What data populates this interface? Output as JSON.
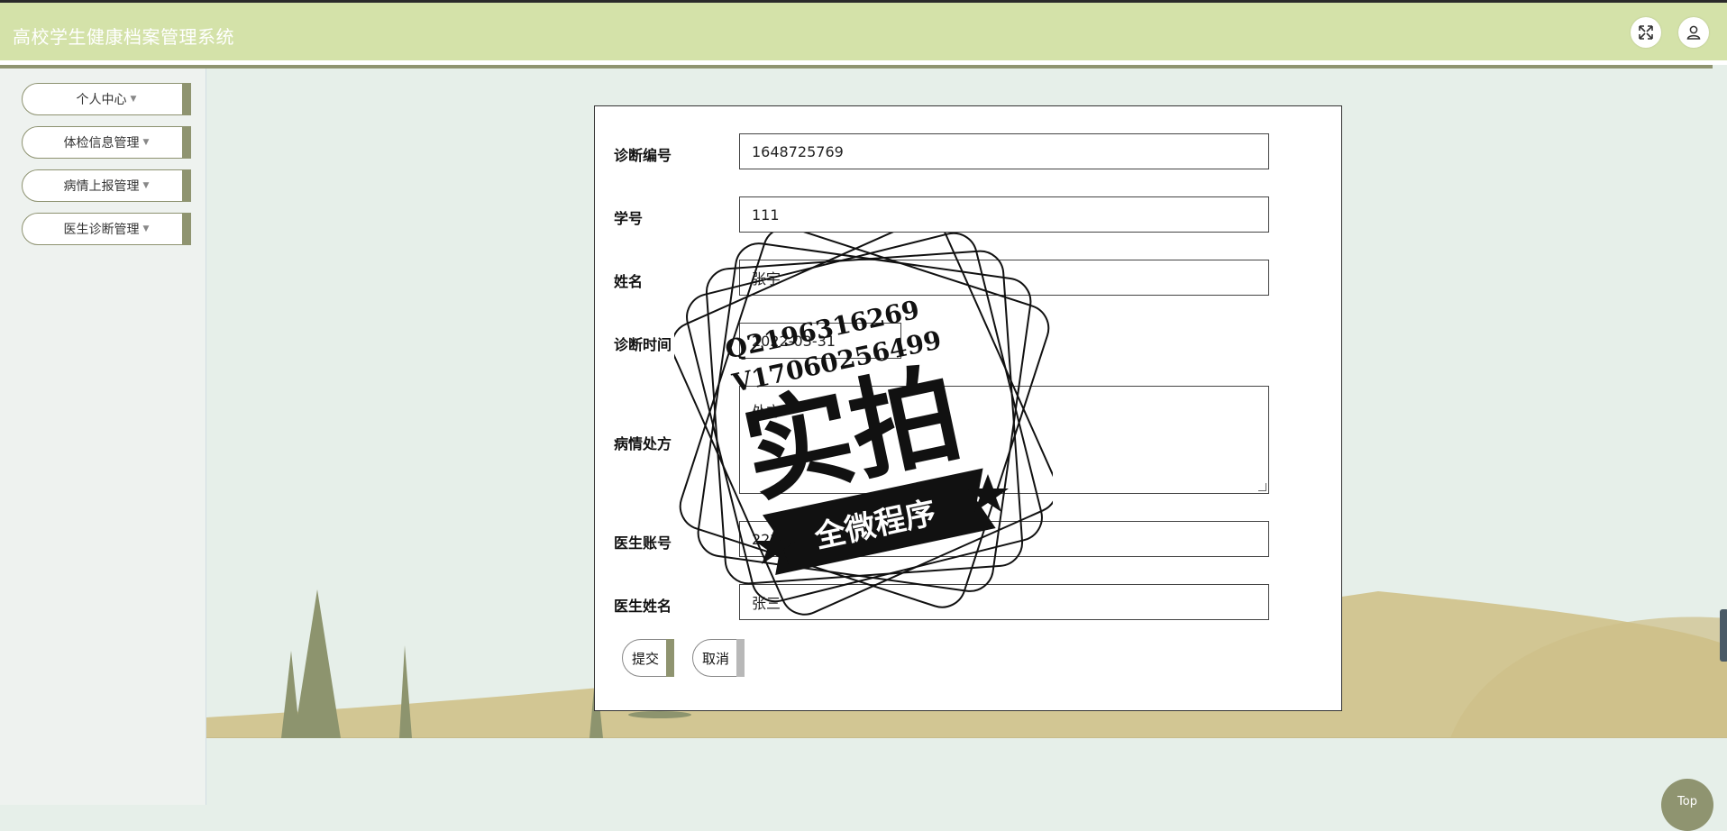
{
  "app": {
    "title": "高校学生健康档案管理系统"
  },
  "header": {
    "fullscreen_icon": "expand-icon",
    "user_icon": "user-icon"
  },
  "sidebar": {
    "items": [
      {
        "label": "个人中心"
      },
      {
        "label": "体检信息管理"
      },
      {
        "label": "病情上报管理"
      },
      {
        "label": "医生诊断管理"
      }
    ]
  },
  "form": {
    "fields": [
      {
        "label": "诊断编号",
        "value": "1648725769"
      },
      {
        "label": "学号",
        "value": "111"
      },
      {
        "label": "姓名",
        "value": "张宇"
      },
      {
        "label": "诊断时间",
        "value": "2022-03-31"
      },
      {
        "label": "病情处方",
        "value": "处方"
      },
      {
        "label": "医生账号",
        "value": "222"
      },
      {
        "label": "医生姓名",
        "value": "张三"
      }
    ],
    "submit_label": "提交",
    "cancel_label": "取消"
  },
  "watermark": {
    "qq": "Q2196316269",
    "vx": "V17060256499",
    "big_text": "实拍",
    "ribbon_text": "全微程序"
  },
  "scroll_top": {
    "label": "Top"
  },
  "colors": {
    "header_bg": "#d4e2a9",
    "accent": "#8f9470",
    "page_bg": "#e6efe9",
    "hill": "#d2c693",
    "tree": "#8d946e"
  }
}
